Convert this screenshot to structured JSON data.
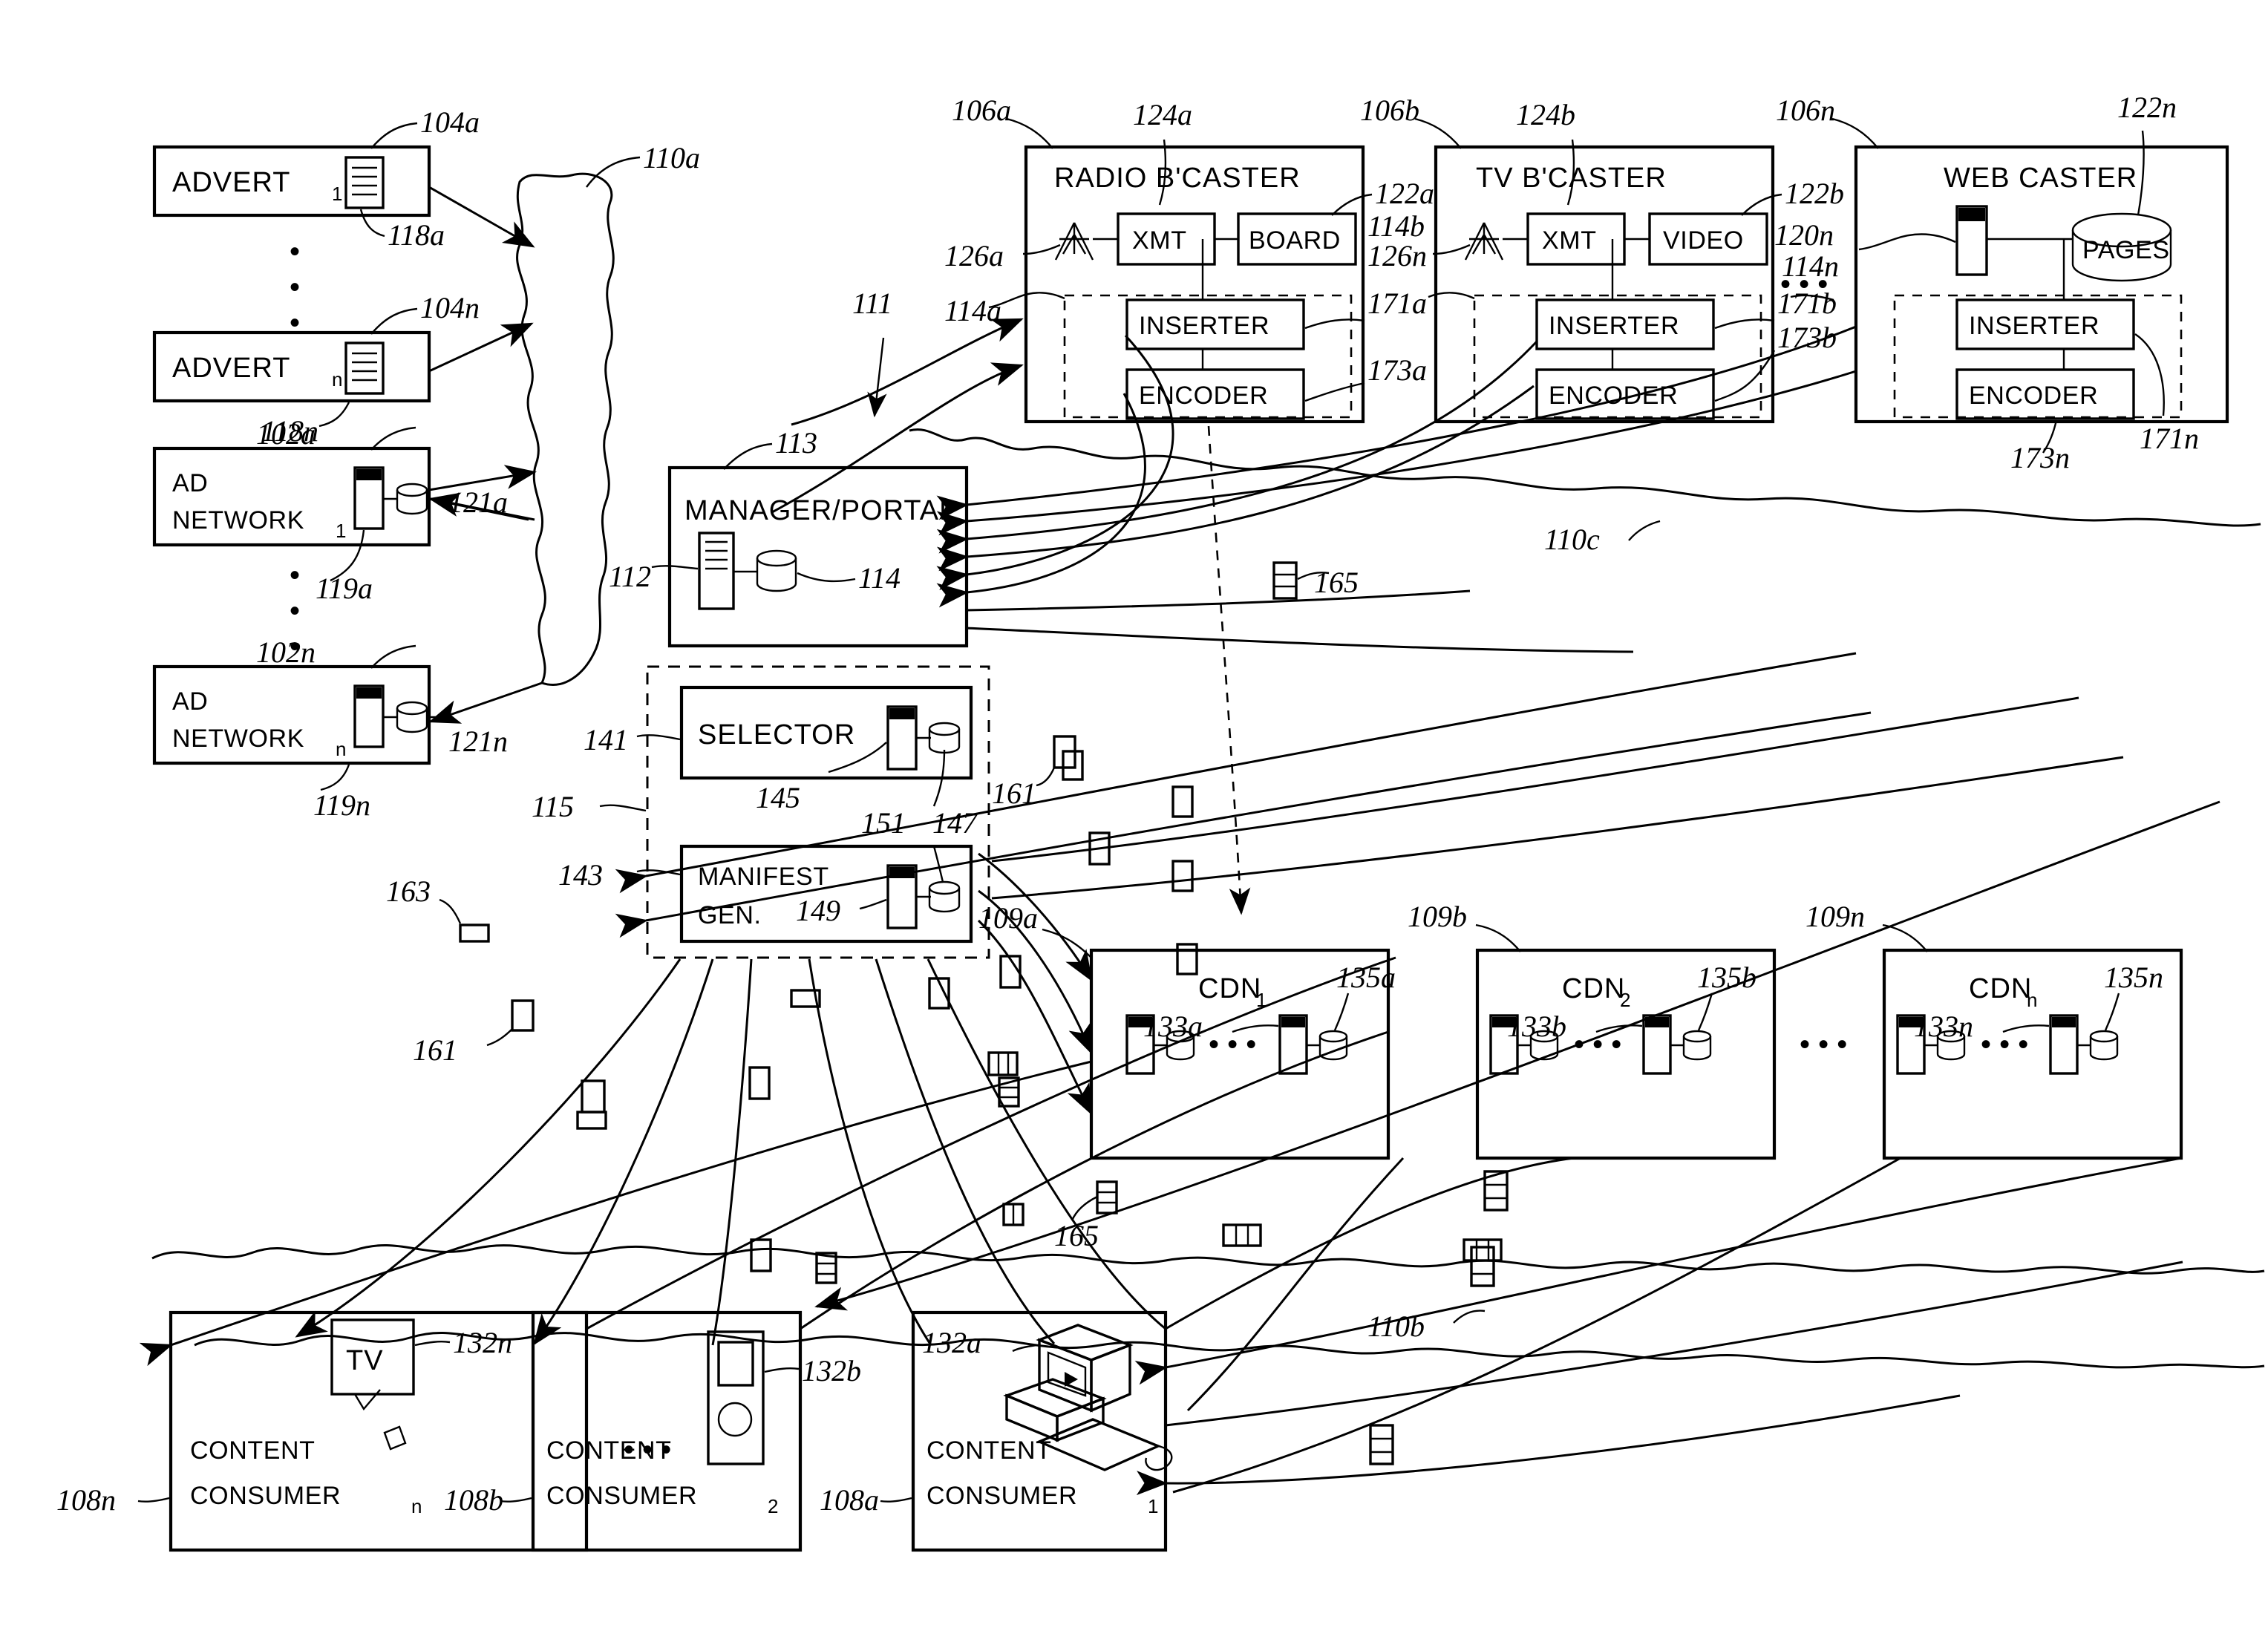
{
  "figure": {
    "type": "patent-block-diagram",
    "title_absent": true
  },
  "blocks": {
    "advert_1": {
      "label": "ADVERT",
      "sub": "1",
      "ref": "104a",
      "icon_ref": "118a",
      "icon": "document-icon"
    },
    "advert_n": {
      "label": "ADVERT",
      "sub": "n",
      "ref": "104n",
      "icon_ref": "118n",
      "icon": "document-icon"
    },
    "ad_network_1": {
      "label_line1": "AD",
      "label_line2": "NETWORK",
      "sub": "1",
      "ref": "102a",
      "server_ref": "121a",
      "db_ref": "119a"
    },
    "ad_network_n": {
      "label_line1": "AD",
      "label_line2": "NETWORK",
      "sub": "n",
      "ref": "102n",
      "server_ref": "121n",
      "db_ref": "119n"
    },
    "manager_portal": {
      "label": "MANAGER/PORTAL",
      "ref": "113",
      "server_ref": "112",
      "db_ref": "114"
    },
    "selector": {
      "label": "SELECTOR",
      "ref": "141",
      "server_ref": "145",
      "db_ref": "147",
      "link_ref": "151"
    },
    "manifest_gen": {
      "label_line1": "MANIFEST",
      "label_line2": "GEN.",
      "ref": "143",
      "server_ref": "149"
    },
    "selector_group": {
      "ref": "115"
    },
    "radio_bcaster": {
      "label": "RADIO  B'CASTER",
      "ref": "106a",
      "title_ref": "124a",
      "antenna_ref": "126a",
      "group_ref": "114a",
      "xmt": "XMT",
      "board": "BOARD",
      "board_ref": "122a",
      "inserter": "INSERTER",
      "inserter_ref": "171a",
      "encoder": "ENCODER",
      "encoder_ref": "173a"
    },
    "tv_bcaster": {
      "label": "TV  B'CASTER",
      "ref": "106b",
      "title_ref": "124b",
      "antenna_ref": "126n",
      "group_ref": "114b",
      "xmt": "XMT",
      "video": "VIDEO",
      "video_ref": "122b",
      "inserter": "INSERTER",
      "inserter_ref": "171b",
      "encoder": "ENCODER",
      "encoder_ref": "173b"
    },
    "web_caster": {
      "label": "WEB  CASTER",
      "ref": "106n",
      "server_ref": "120n",
      "pages": "PAGES",
      "pages_ref": "122n",
      "group_ref": "114n",
      "inserter": "INSERTER",
      "inserter_ref": "171n",
      "encoder": "ENCODER",
      "encoder_ref": "173n"
    },
    "cdn_1": {
      "label": "CDN",
      "sub": "1",
      "ref": "109a",
      "server_ref": "133a",
      "db_ref": "135a"
    },
    "cdn_2": {
      "label": "CDN",
      "sub": "2",
      "ref": "109b",
      "server_ref": "133b",
      "db_ref": "135b"
    },
    "cdn_n": {
      "label": "CDN",
      "sub": "n",
      "ref": "109n",
      "server_ref": "133n",
      "db_ref": "135n"
    },
    "content_consumer_n": {
      "label_line1": "CONTENT",
      "label_line2": "CONSUMER",
      "sub": "n",
      "ref": "108n",
      "device": "TV",
      "device_ref": "132n"
    },
    "content_consumer_2": {
      "label_line1": "CONTENT",
      "label_line2": "CONSUMER",
      "sub": "2",
      "ref": "108b",
      "device_ref": "132b",
      "device": "portable-media-player-icon"
    },
    "content_consumer_1": {
      "label_line1": "CONTENT",
      "label_line2": "CONSUMER",
      "sub": "1",
      "ref": "108a",
      "device_ref": "132a",
      "device": "desktop-computer-icon"
    }
  },
  "network_clouds": {
    "cloud_a": {
      "ref": "110a"
    },
    "cloud_b": {
      "ref": "110b"
    },
    "cloud_c": {
      "ref": "110c"
    }
  },
  "flow_refs": {
    "content_stream": "111",
    "manifest_flow_left": "161",
    "manifest_flow_mid": "161",
    "ad_marker_left": "163",
    "segment_marker_top": "165",
    "segment_marker_bottom": "165"
  },
  "ellipsis": "• • •"
}
